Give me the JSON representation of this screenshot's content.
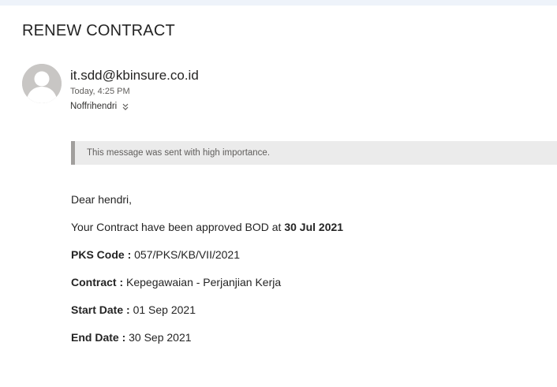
{
  "email": {
    "subject": "RENEW CONTRACT",
    "sender": "it.sdd@kbinsure.co.id",
    "timestamp": "Today, 4:25 PM",
    "recipient": "Noffrihendri",
    "importance_notice": "This message was sent with high importance.",
    "body": {
      "greeting": "Dear hendri,",
      "approval_text": "Your Contract have been approved BOD at ",
      "approval_date": "30 Jul 2021",
      "pks_label": "PKS Code :",
      "pks_value": " 057/PKS/KB/VII/2021",
      "contract_label": "Contract :",
      "contract_value": " Kepegawaian - Perjanjian Kerja",
      "start_label": "Start Date :",
      "start_value": " 01 Sep 2021",
      "end_label": "End Date :",
      "end_value": " 30 Sep 2021"
    }
  },
  "icons": {
    "avatar": "person-avatar-icon",
    "expand": "chevron-double-down-icon"
  },
  "colors": {
    "avatar_bg": "#c8c6c4",
    "banner_bg": "#ebebeb",
    "banner_border": "#a19f9d"
  }
}
